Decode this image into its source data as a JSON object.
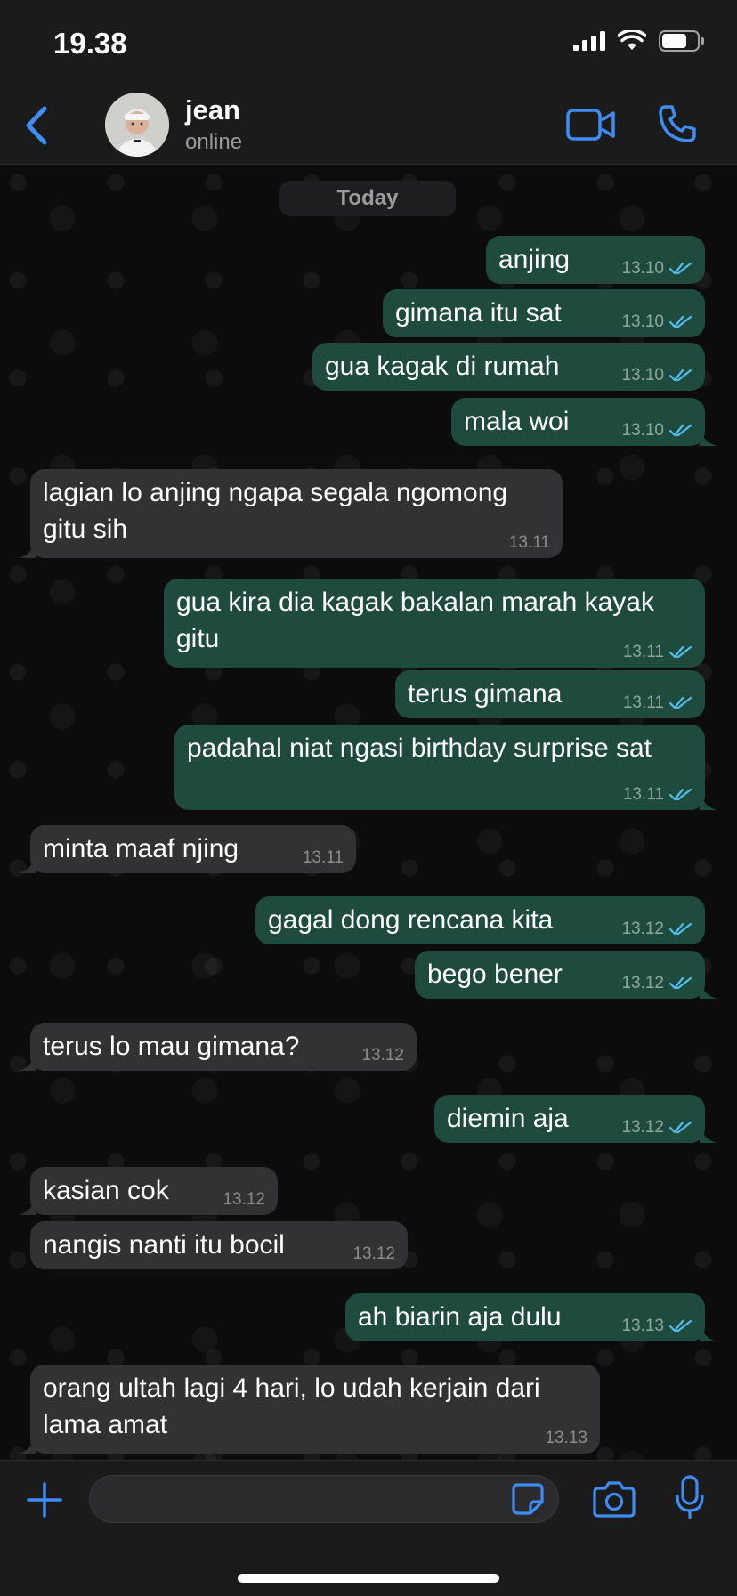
{
  "status_bar": {
    "time": "19.38"
  },
  "header": {
    "contact_name": "jean",
    "contact_status": "online"
  },
  "chat": {
    "date_label": "Today",
    "messages": [
      {
        "text": "anjing",
        "time": "13.10",
        "dir": "out",
        "read": true
      },
      {
        "text": "gimana itu sat",
        "time": "13.10",
        "dir": "out",
        "read": true
      },
      {
        "text": "gua kagak di rumah",
        "time": "13.10",
        "dir": "out",
        "read": true
      },
      {
        "text": "mala woi",
        "time": "13.10",
        "dir": "out",
        "read": true
      },
      {
        "text": "lagian lo anjing ngapa segala ngomong",
        "text2": "gitu sih",
        "time": "13.11",
        "dir": "in"
      },
      {
        "text": "gua kira dia kagak bakalan marah kayak",
        "text2": "gitu",
        "time": "13.11",
        "dir": "out",
        "read": true
      },
      {
        "text": "terus gimana",
        "time": "13.11",
        "dir": "out",
        "read": true
      },
      {
        "text": "padahal niat ngasi birthday surprise sat",
        "time": "13.11",
        "dir": "out",
        "read": true
      },
      {
        "text": "minta maaf njing",
        "time": "13.11",
        "dir": "in"
      },
      {
        "text": "gagal dong rencana kita",
        "time": "13.12",
        "dir": "out",
        "read": true
      },
      {
        "text": "bego bener",
        "time": "13.12",
        "dir": "out",
        "read": true
      },
      {
        "text": "terus lo mau gimana?",
        "time": "13.12",
        "dir": "in"
      },
      {
        "text": "diemin aja",
        "time": "13.12",
        "dir": "out",
        "read": true
      },
      {
        "text": "kasian cok",
        "time": "13.12",
        "dir": "in"
      },
      {
        "text": "nangis nanti itu bocil",
        "time": "13.12",
        "dir": "in"
      },
      {
        "text": "ah biarin aja dulu",
        "time": "13.13",
        "dir": "out",
        "read": true
      },
      {
        "text": "orang ultah lagi 4 hari, lo udah kerjain dari",
        "text2": "lama amat",
        "time": "13.13",
        "dir": "in"
      }
    ]
  },
  "input_bar": {
    "placeholder": ""
  },
  "colors": {
    "outgoing_bubble": "#1f4b3e",
    "incoming_bubble": "#323235",
    "accent_blue": "#3f8cf5",
    "read_tick": "#53bdeb"
  },
  "icons": [
    "back-icon",
    "video-call-icon",
    "phone-icon",
    "double-tick-icon",
    "plus-icon",
    "sticker-icon",
    "camera-icon",
    "microphone-icon"
  ]
}
